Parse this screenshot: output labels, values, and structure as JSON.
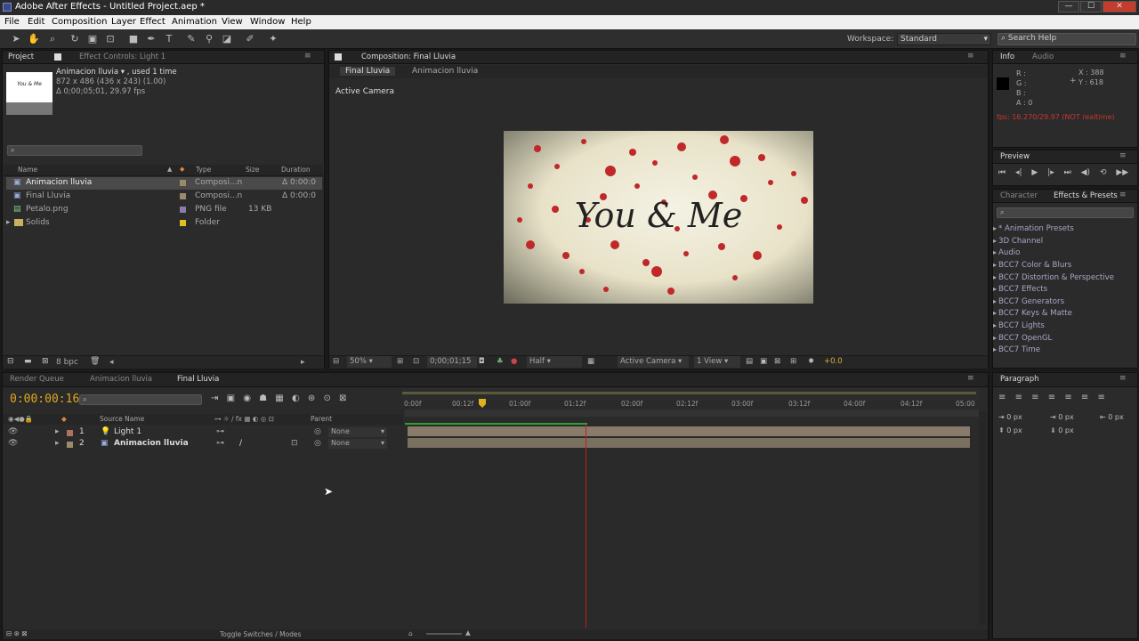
{
  "window": {
    "title": "Adobe After Effects - Untitled Project.aep *",
    "min": "—",
    "max": "☐",
    "close": "✕"
  },
  "menu": [
    "File",
    "Edit",
    "Composition",
    "Layer",
    "Effect",
    "Animation",
    "View",
    "Window",
    "Help"
  ],
  "workspace": {
    "label": "Workspace:",
    "value": "Standard"
  },
  "search_help": "Search Help",
  "project": {
    "tab": "Project",
    "effect_controls": "Effect Controls: Light 1",
    "thumb_text": "You & Me",
    "item_name": "Animacion lluvia ▾ , used 1 time",
    "dims": "872 x 486  (436 x 243) (1.00)",
    "dur": "Δ 0;00;05;01, 29.97 fps",
    "cols": [
      "Name",
      "Type",
      "Size",
      "Duration"
    ],
    "items": [
      {
        "name": "Animacion lluvia",
        "type": "Composi...n",
        "size": "",
        "dur": "Δ 0:00:0",
        "color": "#9a8a6a",
        "icon": "▣"
      },
      {
        "name": "Final Lluvia",
        "type": "Composi...n",
        "size": "",
        "dur": "Δ 0:00:0",
        "color": "#9a8a6a",
        "icon": "▣"
      },
      {
        "name": "Petalo.png",
        "type": "PNG file",
        "size": "13 KB",
        "dur": "",
        "color": "#8a7ab0",
        "icon": "▤"
      },
      {
        "name": "Solids",
        "type": "Folder",
        "size": "",
        "dur": "",
        "color": "#e0c020",
        "icon": "▸"
      }
    ],
    "bpc": "8 bpc"
  },
  "comp": {
    "tab": "Composition: Final Lluvia",
    "sub_tabs": [
      "Final Lluvia",
      "Animacion lluvia"
    ],
    "camera_label": "Active Camera",
    "text": "You & Me",
    "footer": {
      "zoom": "50%",
      "time": "0;00;01;15",
      "res": "Half",
      "camera": "Active Camera",
      "view": "1 View",
      "exposure": "+0.0"
    }
  },
  "info": {
    "tab": "Info",
    "audio": "Audio",
    "r": "R :",
    "g": "G :",
    "b": "B :",
    "a": "A : 0",
    "x": "X : 388",
    "y": "Y : 618",
    "fps": "fps: 16.270/29.97 (NOT realtime)"
  },
  "preview": {
    "tab": "Preview"
  },
  "effects": {
    "tab_char": "Character",
    "tab": "Effects & Presets",
    "items": [
      "* Animation Presets",
      "3D Channel",
      "Audio",
      "BCC7 Color & Blurs",
      "BCC7 Distortion & Perspective",
      "BCC7 Effects",
      "BCC7 Generators",
      "BCC7 Keys & Matte",
      "BCC7 Lights",
      "BCC7 OpenGL",
      "BCC7 Time"
    ]
  },
  "timeline": {
    "tabs": [
      "Render Queue",
      "Animacion lluvia",
      "Final Lluvia"
    ],
    "time": "0:00:00:16",
    "source_name": "Source Name",
    "parent": "Parent",
    "ticks": [
      "0:00f",
      "00:12f",
      "01:00f",
      "01:12f",
      "02:00f",
      "02:12f",
      "03:00f",
      "03:12f",
      "04:00f",
      "04:12f",
      "05:00"
    ],
    "layers": [
      {
        "num": "1",
        "name": "Light 1",
        "parent": "None"
      },
      {
        "num": "2",
        "name": "Animacion lluvia",
        "parent": "None"
      }
    ],
    "toggle": "Toggle Switches / Modes"
  },
  "paragraph": {
    "tab": "Paragraph",
    "px": [
      "0 px",
      "0 px",
      "0 px",
      "0 px",
      "0 px"
    ]
  }
}
